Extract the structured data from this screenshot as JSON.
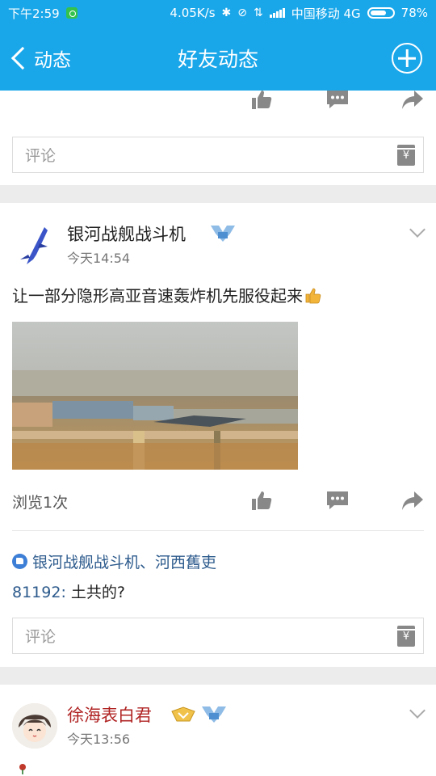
{
  "status_bar": {
    "time": "下午2:59",
    "net_speed": "4.05K/s",
    "carrier": "中国移动 4G",
    "battery": "78%",
    "battery_level": 0.78
  },
  "header": {
    "back_label": "动态",
    "title": "好友动态"
  },
  "comment_placeholder": "评论",
  "comment_button_glyph": "¥",
  "posts": [
    {
      "username": "银河战舰战斗机",
      "time": "今天14:54",
      "text": "让一部分隐形高亚音速轰炸机先服役起来",
      "views": "浏览1次",
      "likes_text": "银河战舰战斗机、河西舊吏",
      "reply_user": "81192:",
      "reply_text": " 土共的?"
    },
    {
      "username": "徐海表白君",
      "time": "今天13:56"
    }
  ],
  "icons": {
    "like": "thumbs-up-icon",
    "comment": "comment-bubble-icon",
    "share": "share-arrow-icon"
  },
  "colors": {
    "accent": "#1aa7ea",
    "link": "#2c5a8c",
    "username_red": "#b02323"
  }
}
